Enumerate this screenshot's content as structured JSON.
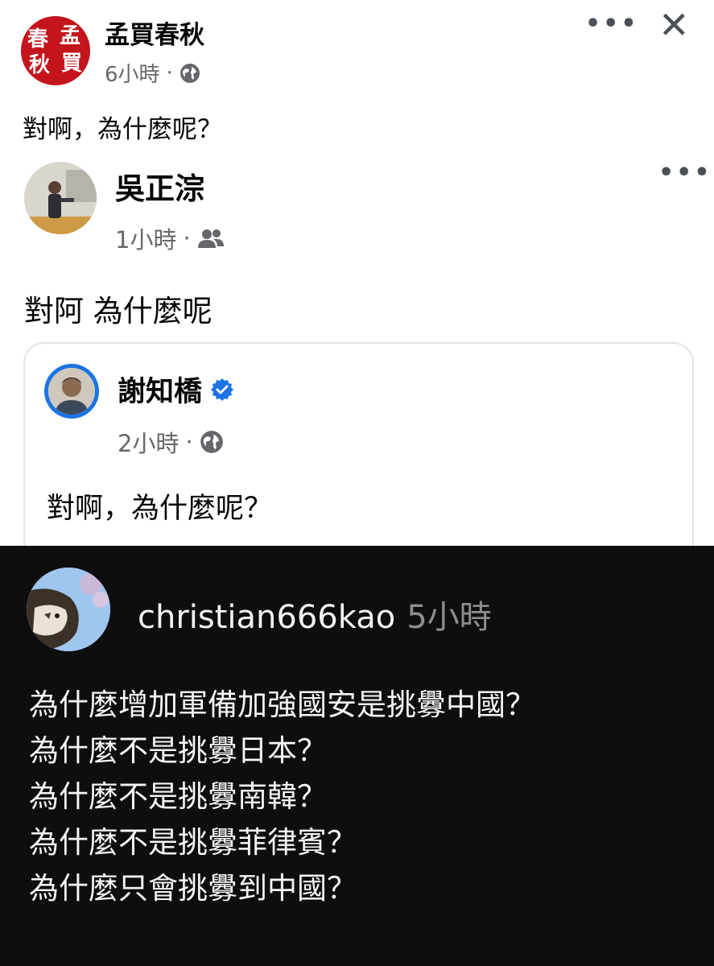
{
  "post": {
    "page_name": "孟買春秋",
    "time": "6小時",
    "separator": "·",
    "privacy_icon": "globe-icon",
    "text": "對啊，為什麼呢？",
    "avatar_chars": [
      "春",
      "孟",
      "秋",
      "買"
    ],
    "avatar_color": "#c3151b"
  },
  "shared_post": {
    "author": "吳正淙",
    "time": "1小時",
    "separator": "·",
    "privacy_icon": "friends-icon",
    "text": "對阿 為什麼呢"
  },
  "quoted_post": {
    "author": "謝知橋",
    "verified_icon": "verified-badge-icon",
    "time": "2小時",
    "separator": "·",
    "privacy_icon": "globe-icon",
    "text": "對啊，為什麼呢？"
  },
  "comment": {
    "username": "christian666kao",
    "time": "5小時",
    "lines": [
      "為什麼增加軍備加強國安是挑釁中國？",
      "為什麼不是挑釁日本？",
      "為什麼不是挑釁南韓？",
      "為什麼不是挑釁菲律賓？",
      "為什麼只會挑釁到中國？"
    ]
  },
  "controls": {
    "more_label": "•••",
    "close_label": "✕"
  },
  "colors": {
    "accent": "#1b74e4",
    "meta_gray": "#65676b",
    "dark_bg": "#0e0e0e"
  }
}
